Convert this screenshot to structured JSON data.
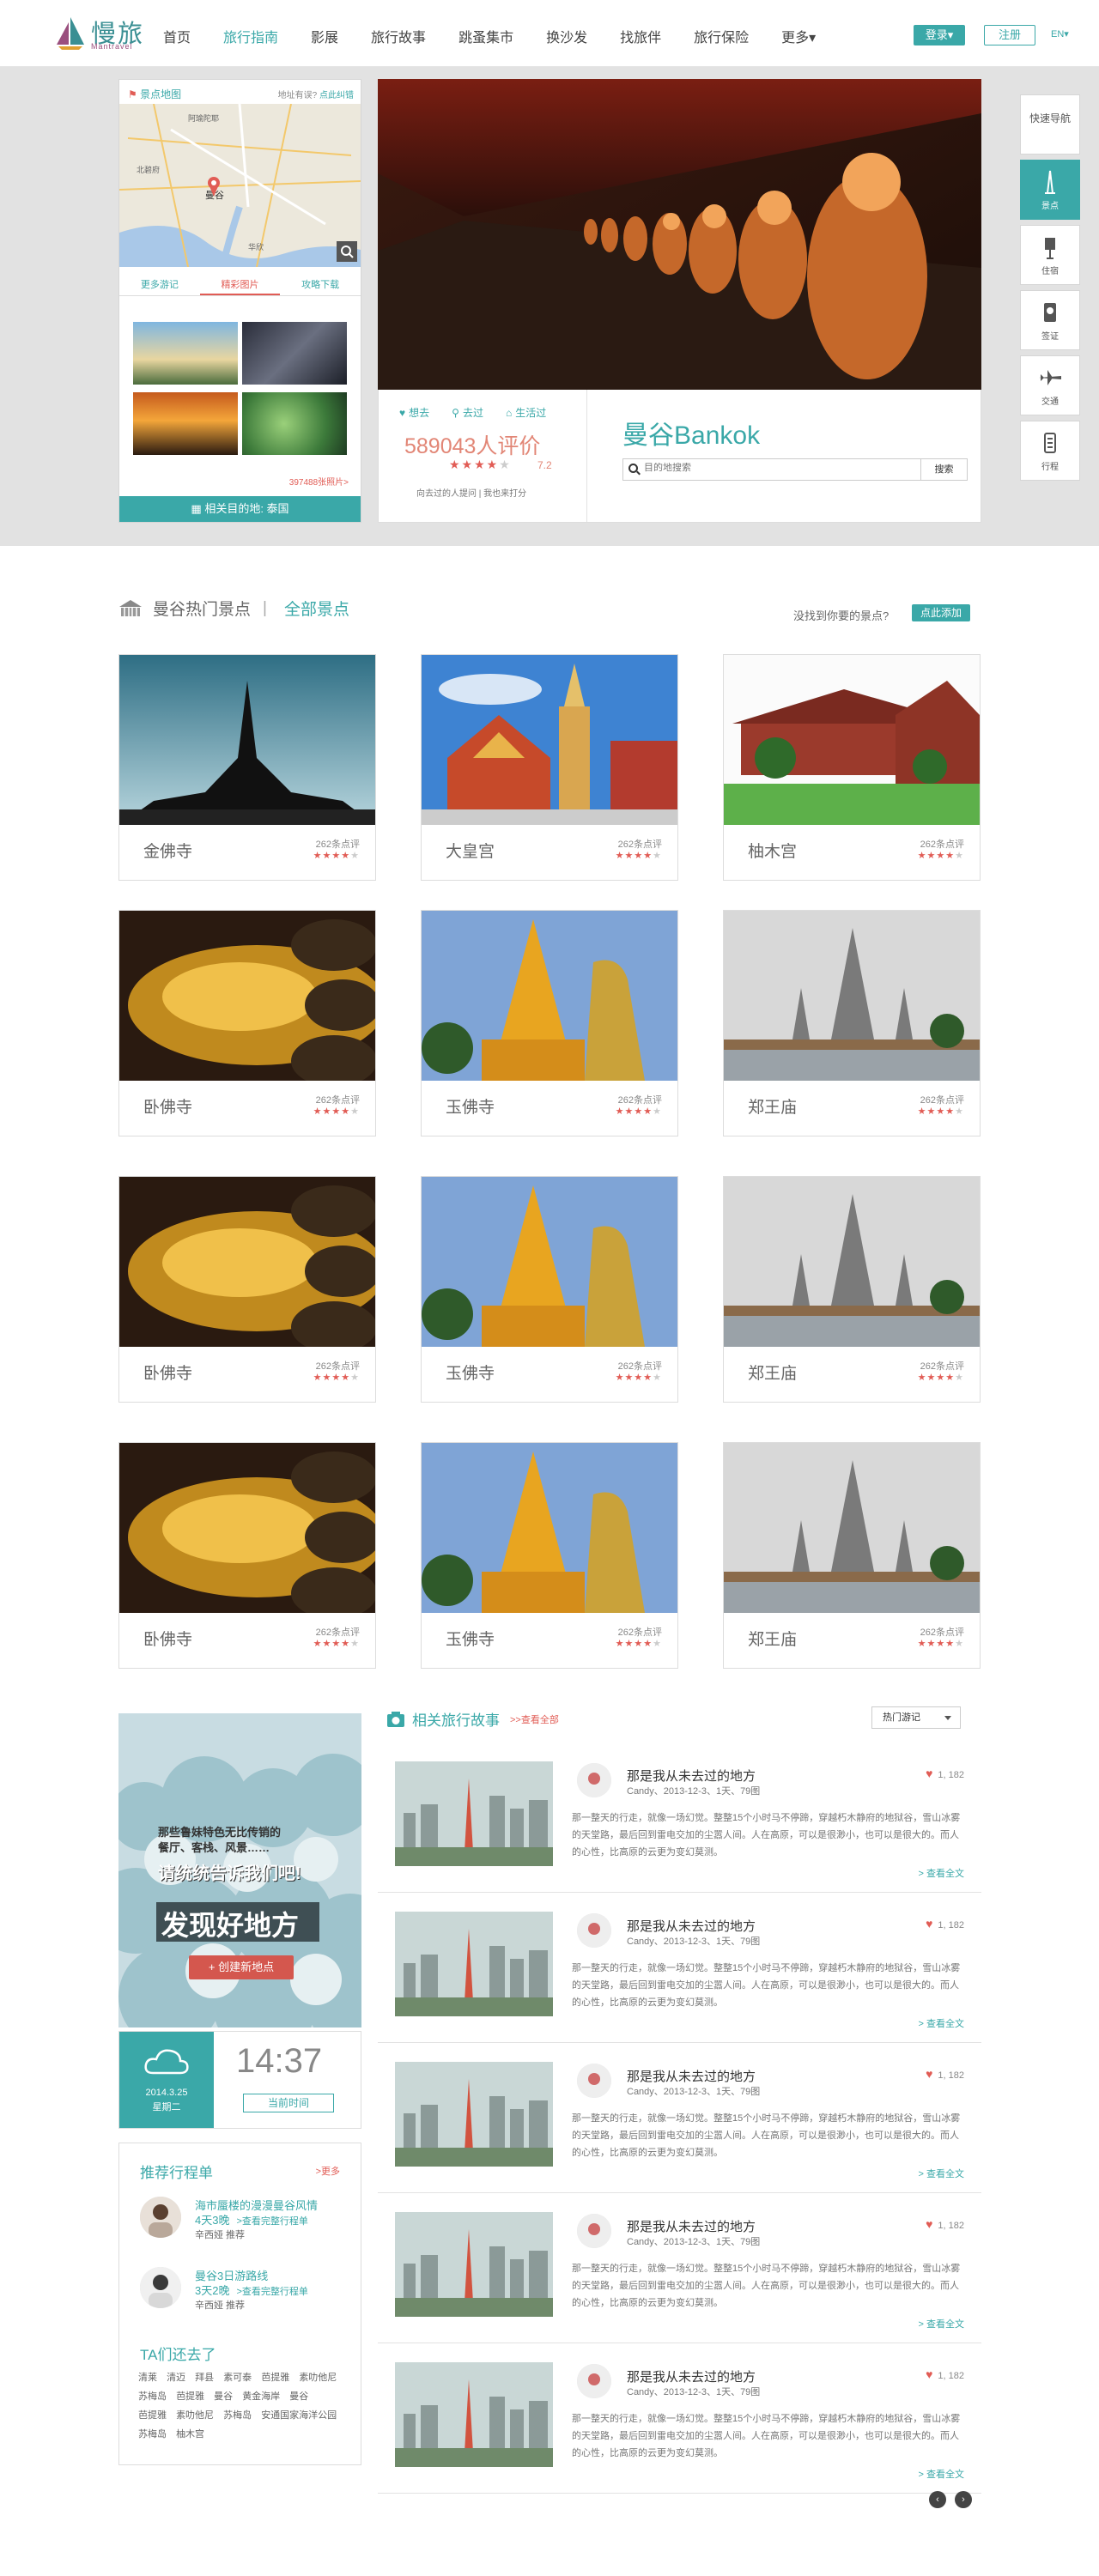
{
  "header": {
    "logo": {
      "cn": "慢旅",
      "en": "Mantravel"
    },
    "nav": [
      {
        "label": "首页"
      },
      {
        "label": "旅行指南"
      },
      {
        "label": "影展"
      },
      {
        "label": "旅行故事"
      },
      {
        "label": "跳蚤集市"
      },
      {
        "label": "换沙发"
      },
      {
        "label": "找旅伴"
      },
      {
        "label": "旅行保险"
      },
      {
        "label": "更多▾"
      }
    ],
    "login": "登录▾",
    "register": "注册",
    "lang": "EN▾"
  },
  "destination": {
    "map_title": "景点地图",
    "map_link_prefix": "地址有误?",
    "map_link": "点此纠错",
    "map_labels": [
      "阿瑜陀耶",
      "曼谷",
      "北碧府",
      "华欣"
    ],
    "tabs": [
      "更多游记",
      "精彩图片",
      "攻略下载"
    ],
    "more_pics": "397488张照片>",
    "related": "相关目的地: 泰国",
    "actions": [
      "想去",
      "去过",
      "生活过"
    ],
    "reviews": "589043人评价",
    "score": "7.2",
    "rate_text": "向去过的人提问 | 我也来打分",
    "city": "曼谷Bankok",
    "search_placeholder": "目的地搜索",
    "search_btn": "搜索"
  },
  "side_nav": [
    {
      "label": "快速导航"
    },
    {
      "label": "景点"
    },
    {
      "label": "住宿"
    },
    {
      "label": "签证"
    },
    {
      "label": "交通"
    },
    {
      "label": "行程"
    }
  ],
  "hot_spots": {
    "title": "曼谷热门景点",
    "all": "全部景点",
    "sep": "|",
    "ask": "没找到你要的景点?",
    "add": "点此添加",
    "cards": [
      {
        "name": "金佛寺",
        "reviews": "262条点评",
        "rating": 4
      },
      {
        "name": "大皇宫",
        "reviews": "262条点评",
        "rating": 4
      },
      {
        "name": "柚木宫",
        "reviews": "262条点评",
        "rating": 4
      },
      {
        "name": "卧佛寺",
        "reviews": "262条点评",
        "rating": 4
      },
      {
        "name": "玉佛寺",
        "reviews": "262条点评",
        "rating": 4
      },
      {
        "name": "郑王庙",
        "reviews": "262条点评",
        "rating": 4
      },
      {
        "name": "卧佛寺",
        "reviews": "262条点评",
        "rating": 4
      },
      {
        "name": "玉佛寺",
        "reviews": "262条点评",
        "rating": 4
      },
      {
        "name": "郑王庙",
        "reviews": "262条点评",
        "rating": 4
      },
      {
        "name": "卧佛寺",
        "reviews": "262条点评",
        "rating": 4
      },
      {
        "name": "玉佛寺",
        "reviews": "262条点评",
        "rating": 4
      },
      {
        "name": "郑王庙",
        "reviews": "262条点评",
        "rating": 4
      }
    ]
  },
  "promo": {
    "line1": "那些鲁妹特色无比传销的",
    "line2": "餐厅、客栈、风景……",
    "line3": "请统统告诉我们吧!",
    "big": "发现好地方",
    "btn": "+ 创建新地点"
  },
  "weather": {
    "date": "2014.3.25",
    "weekday": "星期二",
    "time": "14:37",
    "now_btn": "当前时间"
  },
  "routes": {
    "title": "推荐行程单",
    "more": ">更多",
    "items": [
      {
        "title": "海市蜃楼的漫漫曼谷风情",
        "days": "4天3晚",
        "link": ">查看完整行程单",
        "author": "辛西娅 推荐"
      },
      {
        "title": "曼谷3日游路线",
        "days": "3天2晚",
        "link": ">查看完整行程单",
        "author": "辛西娅 推荐"
      }
    ],
    "ta_title": "TA们还去了",
    "ta_tags": [
      "清莱",
      "清迈",
      "拜县",
      "素可泰",
      "芭提雅",
      "素叻他尼",
      "苏梅岛",
      "芭提雅",
      "曼谷",
      "黄金海岸",
      "曼谷",
      "芭提雅",
      "素叻他尼",
      "苏梅岛",
      "安通国家海洋公园",
      "苏梅岛",
      "柚木宫"
    ]
  },
  "stories": {
    "title": "相关旅行故事",
    "sub": ">>查看全部",
    "select": "热门游记",
    "items": [
      {
        "title": "那是我从未去过的地方",
        "meta": "Candy、2013-12-3、1天、79图",
        "likes": "1, 182",
        "text": "那一整天的行走，就像一场幻觉。整整15个小时马不停蹄，穿越朽木静府的地狱谷，雪山冰雾的天堂路，最后回到雷电交加的尘嚣人间。人在高原，可以是很渺小，也可以是很大的。而人的心性，比高原的云更为变幻莫测。",
        "more": "> 查看全文"
      },
      {
        "title": "那是我从未去过的地方",
        "meta": "Candy、2013-12-3、1天、79图",
        "likes": "1, 182",
        "text": "那一整天的行走，就像一场幻觉。整整15个小时马不停蹄，穿越朽木静府的地狱谷，雪山冰雾的天堂路，最后回到雷电交加的尘嚣人间。人在高原，可以是很渺小，也可以是很大的。而人的心性，比高原的云更为变幻莫测。",
        "more": "> 查看全文"
      },
      {
        "title": "那是我从未去过的地方",
        "meta": "Candy、2013-12-3、1天、79图",
        "likes": "1, 182",
        "text": "那一整天的行走，就像一场幻觉。整整15个小时马不停蹄，穿越朽木静府的地狱谷，雪山冰雾的天堂路，最后回到雷电交加的尘嚣人间。人在高原，可以是很渺小，也可以是很大的。而人的心性，比高原的云更为变幻莫测。",
        "more": "> 查看全文"
      },
      {
        "title": "那是我从未去过的地方",
        "meta": "Candy、2013-12-3、1天、79图",
        "likes": "1, 182",
        "text": "那一整天的行走，就像一场幻觉。整整15个小时马不停蹄，穿越朽木静府的地狱谷，雪山冰雾的天堂路，最后回到雷电交加的尘嚣人间。人在高原，可以是很渺小，也可以是很大的。而人的心性，比高原的云更为变幻莫测。",
        "more": "> 查看全文"
      },
      {
        "title": "那是我从未去过的地方",
        "meta": "Candy、2013-12-3、1天、79图",
        "likes": "1, 182",
        "text": "那一整天的行走，就像一场幻觉。整整15个小时马不停蹄，穿越朽木静府的地狱谷，雪山冰雾的天堂路，最后回到雷电交加的尘嚣人间。人在高原，可以是很渺小，也可以是很大的。而人的心性，比高原的云更为变幻莫测。",
        "more": "> 查看全文"
      }
    ],
    "pager": [
      "‹",
      "›"
    ]
  },
  "colors": {
    "accent": "#3aa8a8",
    "red": "#e15c55",
    "band": "#e2e2e2"
  }
}
